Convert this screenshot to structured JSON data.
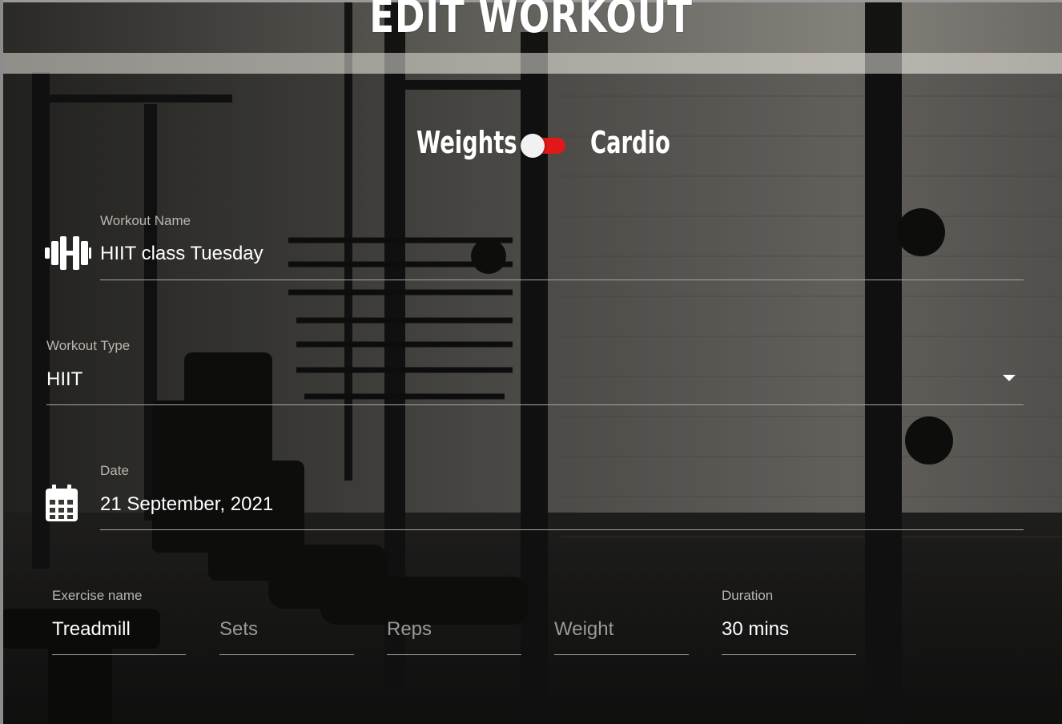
{
  "page": {
    "title": "Edit Workout"
  },
  "toggle": {
    "left_label": "Weights",
    "right_label": "Cardio",
    "state": "Cardio"
  },
  "workout_name": {
    "label": "Workout Name",
    "value": "HIIT class Tuesday"
  },
  "workout_type": {
    "label": "Workout Type",
    "value": "HIIT"
  },
  "date": {
    "label": "Date",
    "value": "21 September, 2021"
  },
  "exercise": {
    "name": {
      "label": "Exercise name",
      "value": "Treadmill"
    },
    "sets": {
      "placeholder": "Sets"
    },
    "reps": {
      "placeholder": "Reps"
    },
    "weight": {
      "placeholder": "Weight"
    },
    "duration": {
      "label": "Duration",
      "value": "30 mins"
    }
  },
  "icons": {
    "workout_name": "dumbbell-icon",
    "date": "calendar-icon",
    "workout_type": "dropdown-caret-icon"
  },
  "colors": {
    "accent": "#e01818",
    "text": "#ffffff",
    "label": "#b9b6b0"
  }
}
